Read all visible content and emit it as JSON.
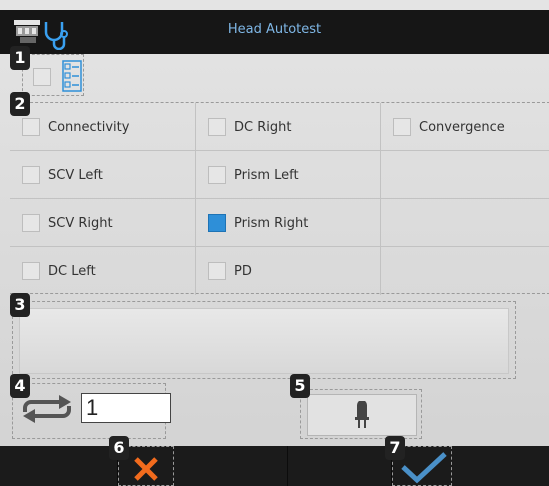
{
  "window": {
    "title": "Head Autotest"
  },
  "badges": [
    "1",
    "2",
    "3",
    "4",
    "5",
    "6",
    "7"
  ],
  "select_all": {
    "checked": false
  },
  "tests": [
    [
      {
        "label": "Connectivity",
        "checked": false
      },
      {
        "label": "DC Right",
        "checked": false
      },
      {
        "label": "Convergence",
        "checked": false
      }
    ],
    [
      {
        "label": "SCV Left",
        "checked": false
      },
      {
        "label": "Prism Left",
        "checked": false
      },
      null
    ],
    [
      {
        "label": "SCV Right",
        "checked": false
      },
      {
        "label": "Prism Right",
        "checked": true
      },
      null
    ],
    [
      {
        "label": "DC Left",
        "checked": false
      },
      {
        "label": "PD",
        "checked": false
      },
      null
    ]
  ],
  "repeat": {
    "count": "1"
  },
  "colors": {
    "accent": "#2e8fd8",
    "title_text": "#7fb7e6",
    "cancel": "#f26b1d",
    "ok": "#4a90c8"
  },
  "icons": {
    "app": "device-stethoscope-icon",
    "select_all": "checklist-icon",
    "repeat": "repeat-icon",
    "lamp": "lamp-icon",
    "cancel": "close-icon",
    "ok": "checkmark-icon"
  }
}
